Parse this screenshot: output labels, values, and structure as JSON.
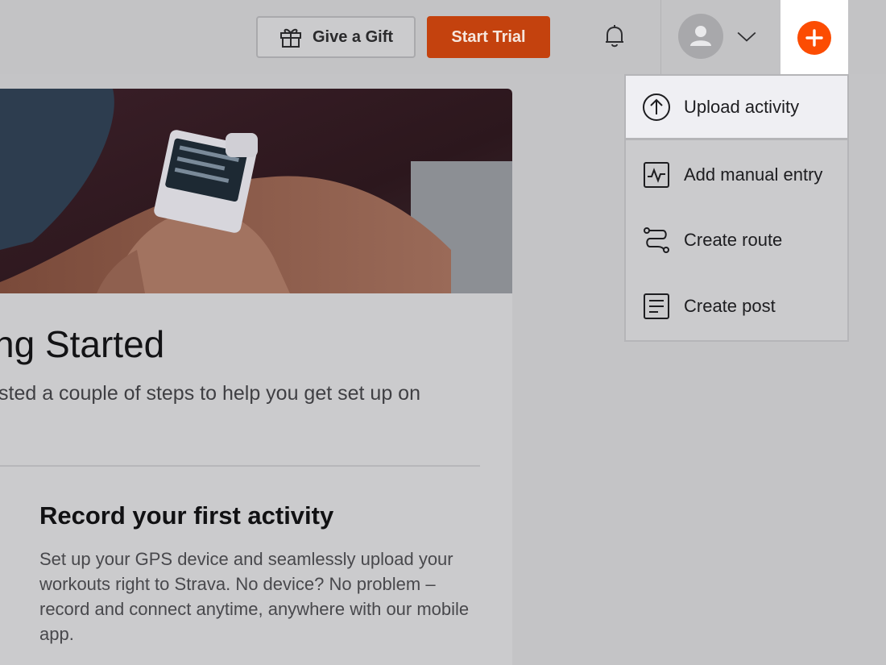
{
  "header": {
    "gift_label": "Give a Gift",
    "trial_label": "Start Trial",
    "accent_color": "#fc4c02"
  },
  "card": {
    "title": "ng Started",
    "subtitle": "sted a couple of steps to help you get set up on",
    "step": {
      "title": "Record your first activity",
      "body": "Set up your GPS device and seamlessly upload your workouts right to Strava. No device? No problem – record and connect anytime, anywhere with our mobile app."
    }
  },
  "menu": {
    "items": [
      {
        "label": "Upload activity",
        "icon": "upload-icon"
      },
      {
        "label": "Add manual entry",
        "icon": "manual-entry-icon"
      },
      {
        "label": "Create route",
        "icon": "route-icon"
      },
      {
        "label": "Create post",
        "icon": "post-icon"
      }
    ]
  }
}
